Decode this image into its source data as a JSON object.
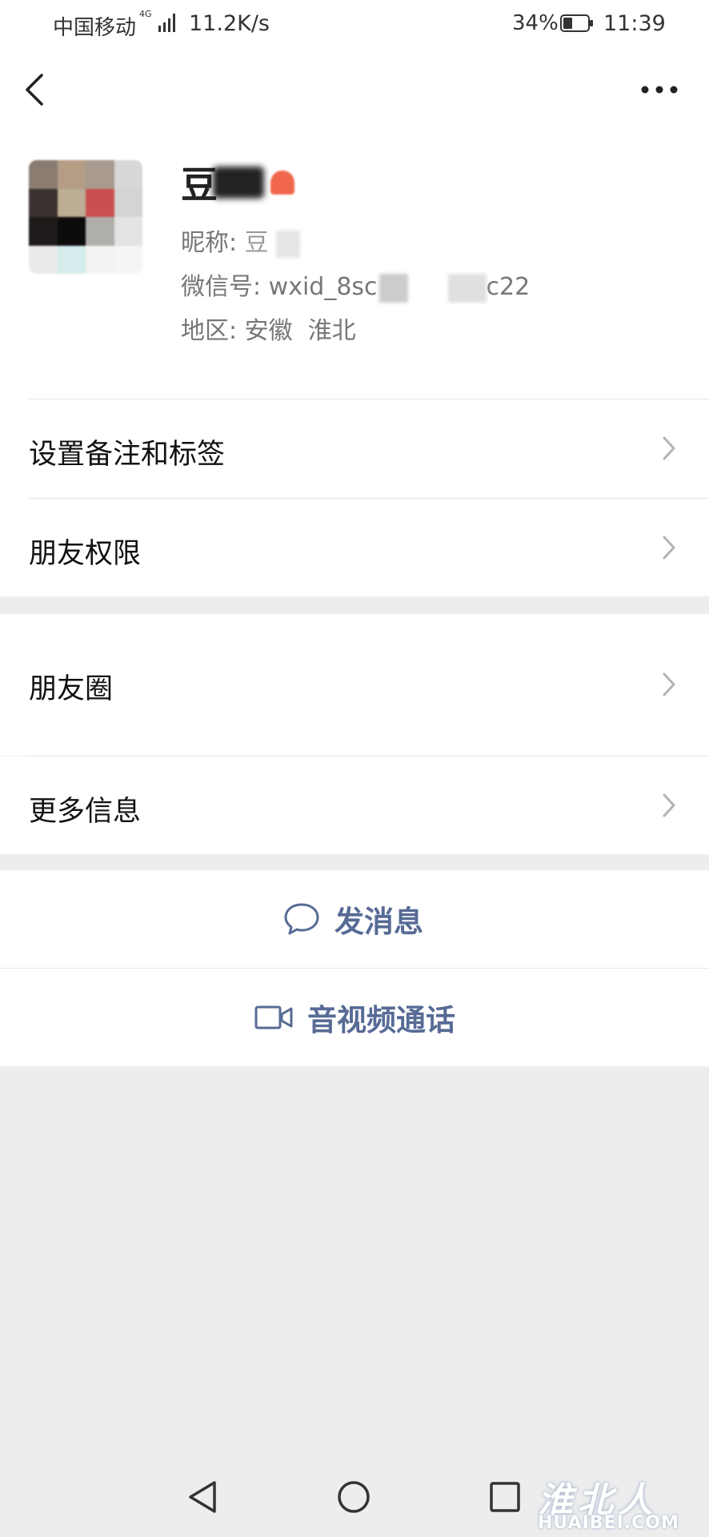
{
  "status_bar": {
    "carrier": "中国移动",
    "network": "4G",
    "speed": "11.2K/s",
    "battery": "34%",
    "time": "11:39"
  },
  "header": {
    "back_icon": "chevron-left-icon",
    "more_icon": "ellipsis-icon"
  },
  "profile": {
    "name_visible": "豆",
    "nickname_label": "昵称:",
    "nickname_value": "豆",
    "wechat_id_label": "微信号:",
    "wechat_id_prefix": "wxid_8sc",
    "wechat_id_suffix": "c22",
    "region_label": "地区:",
    "region_value": "安徽  淮北"
  },
  "menu_group_1": [
    {
      "label": "设置备注和标签"
    },
    {
      "label": "朋友权限"
    }
  ],
  "menu_group_2": [
    {
      "label": "朋友圈"
    },
    {
      "label": "更多信息"
    }
  ],
  "actions": {
    "message": "发消息",
    "message_icon": "chat-bubble-icon",
    "video_call": "音视频通话",
    "video_icon": "video-camera-icon"
  },
  "nav_bar": {
    "back": "triangle-back-icon",
    "home": "circle-home-icon",
    "recents": "square-recents-icon"
  },
  "watermark": {
    "chinese": "淮北人",
    "english": "HUAIBEI.COM"
  }
}
